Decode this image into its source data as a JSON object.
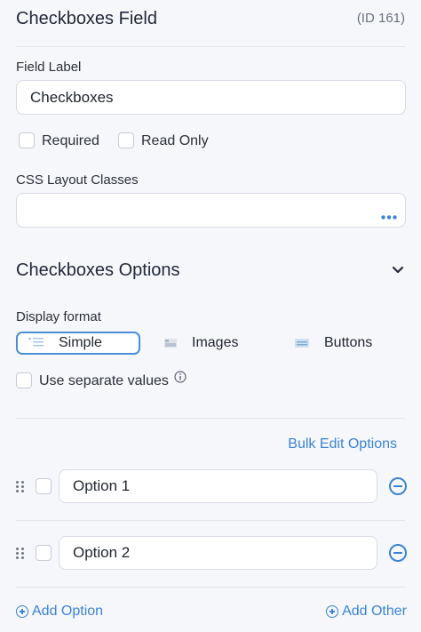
{
  "header": {
    "title": "Checkboxes Field",
    "id_text": "(ID 161)"
  },
  "field_label": {
    "label": "Field Label",
    "value": "Checkboxes"
  },
  "checks": {
    "required": "Required",
    "read_only": "Read Only"
  },
  "css_classes": {
    "label": "CSS Layout Classes",
    "value": "",
    "more_icon": "ellipsis-icon"
  },
  "options_section": {
    "title": "Checkboxes Options",
    "display_format_label": "Display format",
    "formats": [
      {
        "label": "Simple",
        "selected": true
      },
      {
        "label": "Images",
        "selected": false
      },
      {
        "label": "Buttons",
        "selected": false
      }
    ],
    "separate_values": "Use separate values",
    "bulk_edit": "Bulk Edit Options",
    "options": [
      {
        "value": "Option 1"
      },
      {
        "value": "Option 2"
      }
    ],
    "add_option": "Add Option",
    "add_other": "Add Other"
  },
  "colors": {
    "accent": "#3b84d4",
    "background": "#f6f7fb"
  }
}
